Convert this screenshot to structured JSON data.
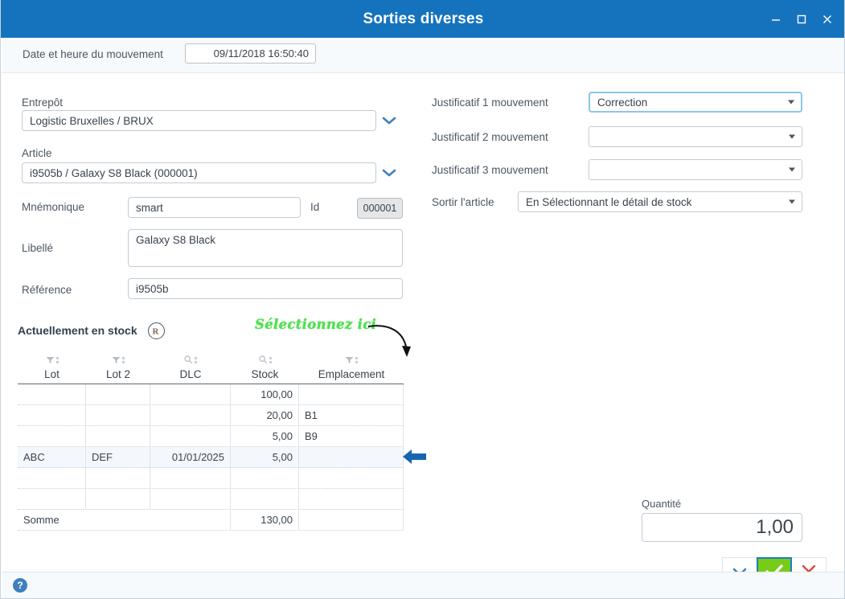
{
  "window": {
    "title": "Sorties diverses",
    "controls": {
      "minimize": "minimize",
      "maximize": "maximize",
      "close": "close"
    }
  },
  "datebar": {
    "label": "Date et heure du mouvement",
    "value": "09/11/2018 16:50:40"
  },
  "left_form": {
    "warehouse_label": "Entrepôt",
    "warehouse_value": "Logistic Bruxelles / BRUX",
    "article_label": "Article",
    "article_value": "i9505b / Galaxy S8 Black (000001)",
    "mnemonic_label": "Mnémonique",
    "mnemonic_value": "smart",
    "id_label": "Id",
    "id_value": "000001",
    "libelle_label": "Libellé",
    "libelle_value": "Galaxy S8 Black",
    "reference_label": "Référence",
    "reference_value": "i9505b"
  },
  "right_form": {
    "justif1_label": "Justificatif 1 mouvement",
    "justif1_value": "Correction",
    "justif2_label": "Justificatif 2 mouvement",
    "justif2_value": "",
    "justif3_label": "Justificatif 3 mouvement",
    "justif3_value": "",
    "sortir_label": "Sortir l'article",
    "sortir_value": "En Sélectionnant le détail de stock"
  },
  "stock": {
    "section_title": "Actuellement en stock",
    "badge": "R",
    "annotation": "Sélectionnez ici",
    "columns": [
      {
        "label": "Lot",
        "icon": "filter-icon"
      },
      {
        "label": "Lot 2",
        "icon": "filter-icon"
      },
      {
        "label": "DLC",
        "icon": "search-icon"
      },
      {
        "label": "Stock",
        "icon": "search-icon"
      },
      {
        "label": "Emplacement",
        "icon": "filter-icon"
      }
    ],
    "rows": [
      {
        "lot": "",
        "lot2": "",
        "dlc": "",
        "stock": "100,00",
        "emplacement": "",
        "selected": false
      },
      {
        "lot": "",
        "lot2": "",
        "dlc": "",
        "stock": "20,00",
        "emplacement": "B1",
        "selected": false
      },
      {
        "lot": "",
        "lot2": "",
        "dlc": "",
        "stock": "5,00",
        "emplacement": "B9",
        "selected": false
      },
      {
        "lot": "ABC",
        "lot2": "DEF",
        "dlc": "01/01/2025",
        "stock": "5,00",
        "emplacement": "",
        "selected": true
      },
      {
        "lot": "",
        "lot2": "",
        "dlc": "",
        "stock": "",
        "emplacement": "",
        "selected": false
      },
      {
        "lot": "",
        "lot2": "",
        "dlc": "",
        "stock": "",
        "emplacement": "",
        "selected": false
      }
    ],
    "sum_row": {
      "label": "Somme",
      "stock": "130,00"
    }
  },
  "quantity": {
    "label": "Quantité",
    "value": "1,00"
  },
  "actions": {
    "dropdown": "chevron-down",
    "confirm": "check",
    "cancel": "cross"
  },
  "footer": {
    "help": "?"
  },
  "colors": {
    "titlebar": "#1573be",
    "accent_blue": "#3f7fbf",
    "confirm_green": "#77cc18",
    "cancel_red": "#d94a3a",
    "annotation_green": "#4ee24e",
    "selected_row": "#f4f8fd"
  }
}
